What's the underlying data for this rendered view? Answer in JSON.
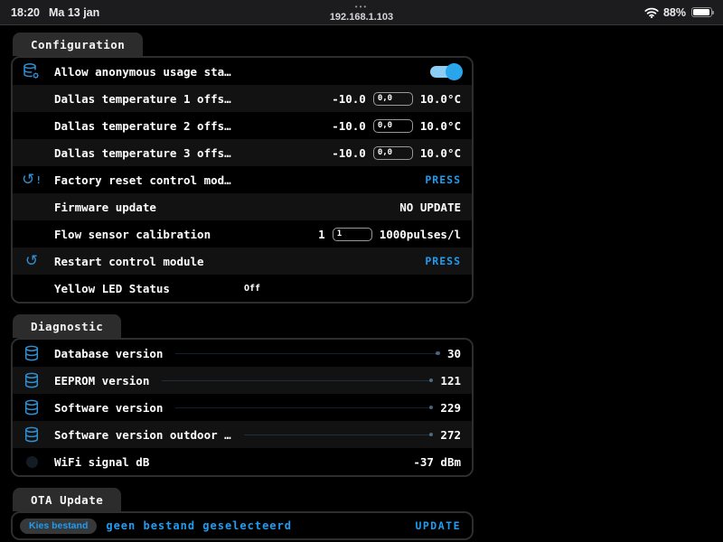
{
  "status_bar": {
    "time": "18:20",
    "date": "Ma 13 jan",
    "dots": "•••",
    "url": "192.168.1.103",
    "battery_percent": "88%"
  },
  "colors": {
    "accent_blue": "#1f9df2",
    "icon_blue": "#2f8fd3",
    "toggle_track": "#8ecdf3",
    "toggle_knob": "#29a5ec",
    "tab_background": "#2c2c2c",
    "panel_border": "#2e2e2e",
    "row_alt": "#121212"
  },
  "sections": [
    {
      "tab": "Configuration",
      "rows": [
        {
          "icon": "database-gear-icon",
          "label": "Allow anonymous usage sta…",
          "type": "toggle",
          "value": "on"
        },
        {
          "label": "Dallas temperature 1 offs…",
          "type": "range",
          "min": "-10.0",
          "value": "0,0",
          "max": "10.0°C"
        },
        {
          "label": "Dallas temperature 2 offs…",
          "type": "range",
          "min": "-10.0",
          "value": "0,0",
          "max": "10.0°C"
        },
        {
          "label": "Dallas temperature 3 offs…",
          "type": "range",
          "min": "-10.0",
          "value": "0,0",
          "max": "10.0°C"
        },
        {
          "icon": "factory-reset-icon",
          "label": "Factory reset control mod…",
          "type": "press",
          "action": "PRESS"
        },
        {
          "label": "Firmware update",
          "type": "text",
          "value": "NO UPDATE"
        },
        {
          "label": "Flow sensor calibration",
          "type": "range",
          "min": "1",
          "value": "1",
          "max": "1000pulses/l"
        },
        {
          "icon": "restart-icon",
          "label": "Restart control module",
          "type": "press",
          "action": "PRESS"
        },
        {
          "label": "Yellow LED Status",
          "type": "status",
          "value": "Off"
        }
      ]
    },
    {
      "tab": "Diagnostic",
      "rows": [
        {
          "icon": "database-icon",
          "label": "Database version",
          "type": "meter",
          "value": "30"
        },
        {
          "icon": "database-icon",
          "label": "EEPROM version",
          "type": "meter",
          "value": "121"
        },
        {
          "icon": "database-icon",
          "label": "Software version",
          "type": "meter",
          "value": "229"
        },
        {
          "icon": "database-icon",
          "label": "Software version outdoor …",
          "type": "meter",
          "value": "272"
        },
        {
          "icon": "dim-circle-icon",
          "label": "WiFi signal dB",
          "type": "text",
          "value": "-37 dBm"
        }
      ]
    },
    {
      "tab": "OTA Update",
      "ota": {
        "choose_button": "Kies bestand",
        "file_status": "geen bestand geselecteerd",
        "update_button": "UPDATE"
      }
    }
  ]
}
